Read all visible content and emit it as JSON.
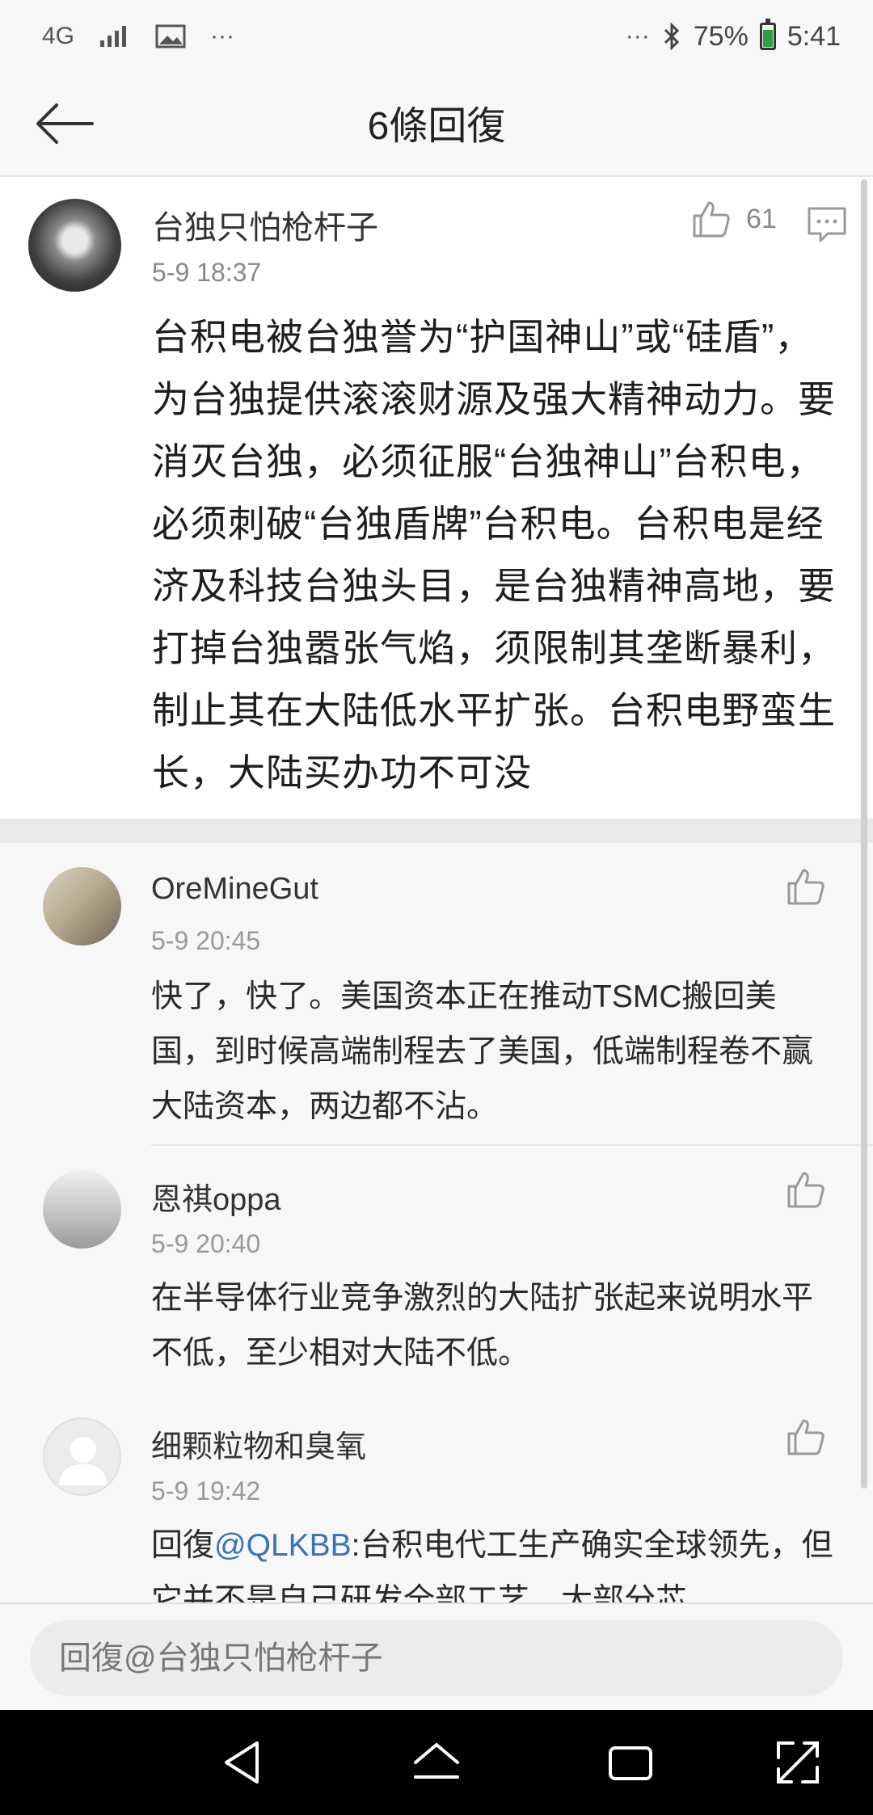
{
  "status_bar": {
    "network": "4G",
    "battery": "75%",
    "time": "5:41",
    "icons": [
      "signal-icon",
      "image-icon",
      "more-icon",
      "bluetooth-icon",
      "battery-icon"
    ],
    "more_glyph": "···"
  },
  "header": {
    "title": "6條回復"
  },
  "main_comment": {
    "username": "台独只怕枪杆子",
    "timestamp": "5-9 18:37",
    "likes": "61",
    "text": "台积电被台独誉为“护国神山”或“硅盾”，为台独提供滚滚财源及强大精神动力。要消灭台独，必须征服“台独神山”台积电，必须刺破“台独盾牌”台积电。台积电是经济及科技台独头目，是台独精神高地，要打掉台独嚣张气焰，须限制其垄断暴利，制止其在大陆低水平扩张。台积电野蛮生长，大陆买办功不可没"
  },
  "replies": [
    {
      "username": "OreMineGut",
      "timestamp": "5-9 20:45",
      "text": "快了，快了。美国资本正在推动TSMC搬回美国，到时候高端制程去了美国，低端制程卷不赢大陆资本，两边都不沾。"
    },
    {
      "username": "恩祺oppa",
      "timestamp": "5-9 20:40",
      "text": "在半导体行业竞争激烈的大陆扩张起来说明水平不低，至少相对大陆不低。"
    },
    {
      "username": "细颗粒物和臭氧",
      "timestamp": "5-9 19:42",
      "prefix": "回復",
      "mention": "@QLKBB",
      "text": ":台积电代工生产确实全球领先，但它并不是自己研发全部工艺，大部分芯"
    }
  ],
  "input": {
    "placeholder": "回復@台独只怕枪杆子"
  },
  "colors": {
    "accent_link": "#3a73b6",
    "battery_fill": "#2ea043"
  }
}
